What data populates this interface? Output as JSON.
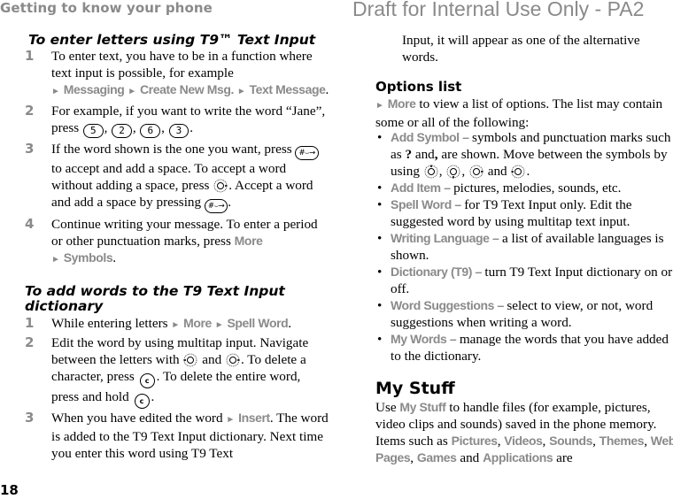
{
  "header": {
    "section": "Getting to know your phone",
    "watermark": "Draft for Internal Use Only - PA2"
  },
  "page_number": "18",
  "left": {
    "t9_heading": "To enter letters using T9™ Text Input",
    "t9_steps": [
      {
        "num": "1",
        "t1": "To enter text, you have to be in a function where text input is possible, for example ",
        "m1": "Messaging",
        "m2": "Create New Msg.",
        "m3": "Text Message",
        "t2": "."
      },
      {
        "num": "2",
        "t1": "For example, if you want to write the word “Jane”, press ",
        "keys": [
          "5",
          "2",
          "6",
          "3"
        ],
        "t2": "."
      },
      {
        "num": "3",
        "t1": "If the word shown is the one you want, press ",
        "t2": " to accept and add a space. To accept a word without adding a space, press ",
        "t3": ". Accept a word and add a space by pressing ",
        "t4": "."
      },
      {
        "num": "4",
        "t1": "Continue writing your message. To enter a period or other punctuation marks, press ",
        "m1": "More",
        "m2": "Symbols",
        "t2": "."
      }
    ],
    "dict_heading": "To add words to the T9 Text Input dictionary",
    "dict_steps": [
      {
        "num": "1",
        "t1": "While entering letters ",
        "m1": "More",
        "m2": "Spell Word",
        "t2": "."
      },
      {
        "num": "2",
        "t1": "Edit the word by using multitap input. Navigate between the letters with ",
        "t2": " and ",
        "t3": ". To delete a character, press ",
        "t4": ". To delete the entire word, press and hold ",
        "t5": "."
      },
      {
        "num": "3",
        "t1": "When you have edited the word ",
        "m1": "Insert",
        "t2": ". The word is added to the T9 Text Input dictionary. Next time you enter this word using T9 Text"
      }
    ],
    "key_hash_label": "#⌣→",
    "key_c_label": "c"
  },
  "right": {
    "continued": "Input, it will appear as one of the alternative words.",
    "options_heading": "Options list",
    "options_intro_menu": "More",
    "options_intro": " to view a list of options. The list may contain some or all of the following:",
    "options": [
      {
        "name": "Add Symbol",
        "desc": "symbols and punctuation marks such as ",
        "desc_b1": "?",
        "desc_mid": " and",
        "desc_b2": ",",
        "desc_end": " are shown. Move between the symbols by using ",
        "desc_and": " and ",
        "desc_tail": "."
      },
      {
        "name": "Add Item",
        "desc": "pictures, melodies, sounds, etc."
      },
      {
        "name": "Spell Word",
        "desc": "for T9 Text Input only. Edit the suggested word by using multitap text input."
      },
      {
        "name": "Writing Language",
        "desc": "a list of available languages is shown."
      },
      {
        "name": "Dictionary (T9)",
        "desc": "turn T9 Text Input dictionary on or off."
      },
      {
        "name": "Word Suggestions",
        "desc": "select to view, or not, word suggestions when writing a word."
      },
      {
        "name": "My Words",
        "desc": "manage the words that you have added to the dictionary."
      }
    ],
    "mystuff_heading": "My Stuff",
    "mystuff": {
      "t1": "Use ",
      "m1": "My Stuff",
      "t2": " to handle files (for example, pictures, video clips and sounds) saved in the phone memory. Items such as ",
      "items": [
        "Pictures",
        "Videos",
        "Sounds",
        "Themes",
        "Web Pages",
        "Games",
        "Applications"
      ],
      "sep": ", ",
      "and": " and ",
      "tail": " are"
    }
  },
  "symbols": {
    "arrow": "►",
    "bullet": "•",
    "dash": " – "
  }
}
